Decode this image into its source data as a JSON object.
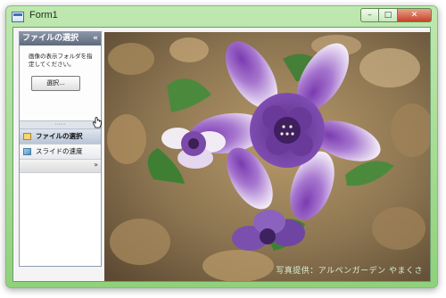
{
  "window": {
    "title": "Form1",
    "controls": {
      "minimize": "–",
      "maximize": "□",
      "close": "✕"
    }
  },
  "nav": {
    "header": "ファイルの選択",
    "collapse_glyph": "«",
    "description": "画像の表示フォルダを指定してください。",
    "select_button": "選択...",
    "splitter_glyph": "⋯⋯",
    "items": [
      {
        "label": "ファイルの選択",
        "icon": "folder-icon"
      },
      {
        "label": "スライドの速度",
        "icon": "slides-icon"
      }
    ],
    "footer_glyph": "»"
  },
  "photo": {
    "caption": "写真提供：アルペンガーデン やまくさ"
  }
}
